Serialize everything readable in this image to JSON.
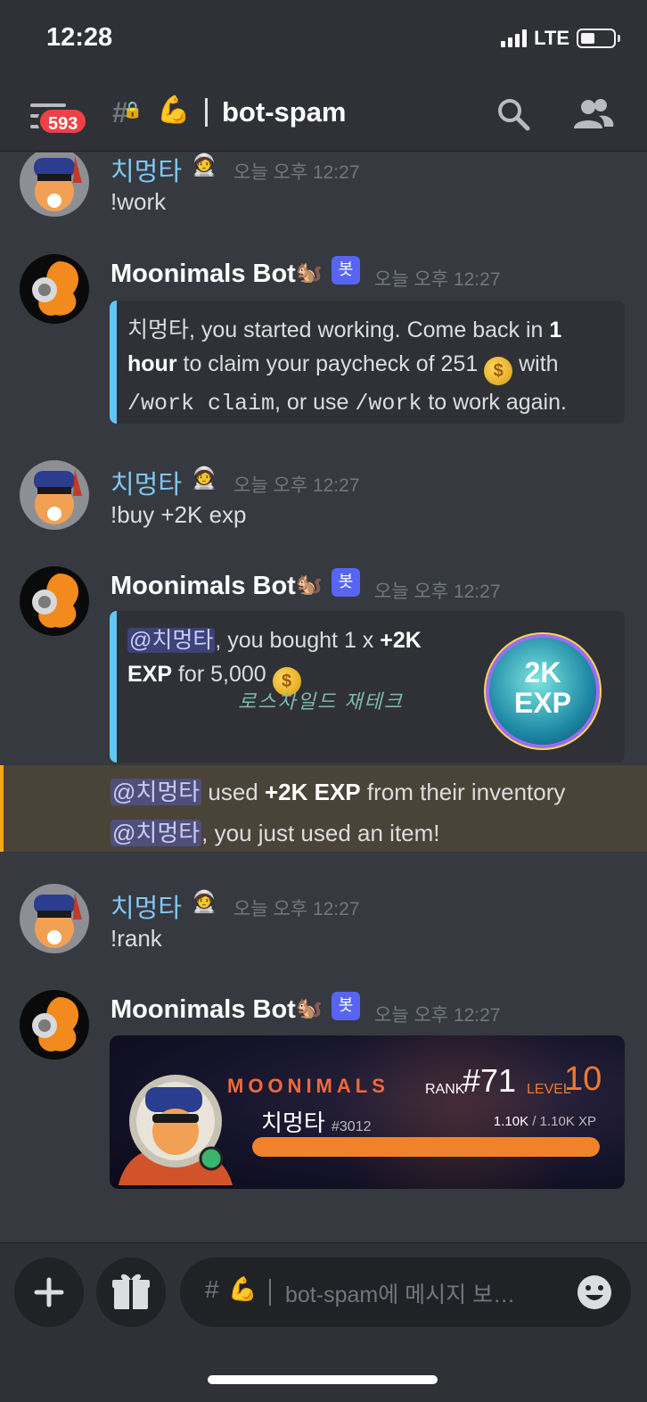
{
  "status_bar": {
    "time": "12:28",
    "network": "LTE"
  },
  "header": {
    "badge_count": "593",
    "channel_name": "bot-spam"
  },
  "messages": [
    {
      "author": "치멍타",
      "timestamp": "오늘 오후 12:27",
      "text": "!work"
    },
    {
      "author": "Moonimals Bot",
      "bot_tag": "봇",
      "timestamp": "오늘 오후 12:27",
      "embed": {
        "p1": "치멍타",
        "p2": ", you started working. Come back in ",
        "p3": "1 hour",
        "p4": " to claim your paycheck of 251 ",
        "p5": " with ",
        "p6": "/work claim",
        "p7": ", or use ",
        "p8": "/work",
        "p9": " to work again."
      }
    },
    {
      "author": "치멍타",
      "timestamp": "오늘 오후 12:27",
      "text": "!buy +2K exp"
    },
    {
      "author": "Moonimals Bot",
      "bot_tag": "봇",
      "timestamp": "오늘 오후 12:27",
      "embed": {
        "mention": "@치멍타",
        "p1": ", you bought 1 x ",
        "p2": "+2K EXP",
        "p3": " for 5,000 ",
        "orb_line1": "2K",
        "orb_line2": "EXP",
        "watermark": "로스차일드 재테크"
      }
    },
    {
      "system": true,
      "line1": {
        "mention": "@치멍타",
        "t1": " used ",
        "bold": "+2K EXP",
        "t2": " from their inventory"
      },
      "line2": {
        "mention": "@치멍타",
        "t1": ", you just used an item!"
      }
    },
    {
      "author": "치멍타",
      "timestamp": "오늘 오후 12:27",
      "text": "!rank"
    },
    {
      "author": "Moonimals Bot",
      "bot_tag": "봇",
      "timestamp": "오늘 오후 12:27",
      "rank_card": {
        "logo": "MOONIMALS",
        "rank_label": "RANK",
        "rank": "#71",
        "level_label": "LEVEL",
        "level": "10",
        "username": "치멍타",
        "discriminator": "#3012",
        "xp_current": "1.10K",
        "xp_max": "/ 1.10K XP",
        "xp_progress": 1.0
      }
    }
  ],
  "composer": {
    "placeholder": "bot-spam에 메시지 보…"
  },
  "colors": {
    "background": "#36393f",
    "header": "#2f3136",
    "blurple": "#5865f2",
    "user_name": "#7ec9f5",
    "embed_bar": "#5ec8f8",
    "highlight_border": "#faa61a",
    "xp_bar": "#f0822e"
  },
  "icons": [
    "menu-icon",
    "channel-hash-icon",
    "lock-icon",
    "flexed-arm-icon",
    "search-icon",
    "members-icon",
    "coin-icon",
    "plus-icon",
    "gift-icon",
    "emoji-icon"
  ]
}
